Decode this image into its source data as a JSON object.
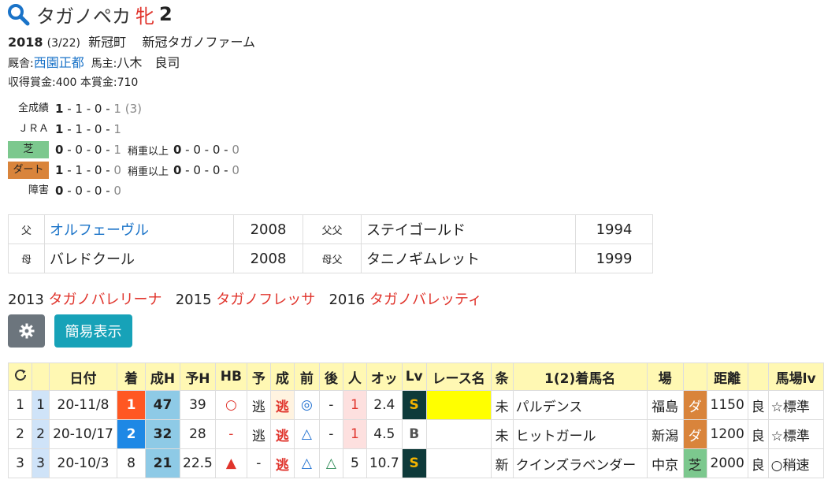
{
  "horse": {
    "name": "タガノペカ",
    "sex": "牝",
    "age": "2"
  },
  "info": {
    "birth_year": "2018",
    "birth_date": "(3/22)",
    "birthplace": "新冠町",
    "breeder": "新冠タガノファーム",
    "trainer_label": "厩舎:",
    "trainer": "西園正都",
    "owner_label": "馬主:",
    "owner": "八木　良司",
    "prize": "収得賞金:400 本賞金:710"
  },
  "records": [
    {
      "label": "全成績",
      "n1": "1",
      "n2": "1",
      "n3": "0",
      "n4": "1",
      "extra": "(3)"
    },
    {
      "label": "ＪＲＡ",
      "n1": "1",
      "n2": "1",
      "n3": "0",
      "n4": "1"
    },
    {
      "label": "芝",
      "n1": "0",
      "n2": "0",
      "n3": "0",
      "n4": "1",
      "sub": "稍重以上",
      "s1": "0",
      "s2": "0",
      "s3": "0",
      "s4": "0"
    },
    {
      "label": "ダート",
      "n1": "1",
      "n2": "1",
      "n3": "0",
      "n4": "0",
      "sub": "稍重以上",
      "s1": "0",
      "s2": "0",
      "s3": "0",
      "s4": "0"
    },
    {
      "label": "障害",
      "n1": "0",
      "n2": "0",
      "n3": "0",
      "n4": "0"
    }
  ],
  "pedigree": [
    {
      "k1": "父",
      "v1": "オルフェーヴル",
      "y1": "2008",
      "k2": "父父",
      "v2": "ステイゴールド",
      "y2": "1994"
    },
    {
      "k1": "母",
      "v1": "バレドクール",
      "y1": "2008",
      "k2": "母父",
      "v2": "タニノギムレット",
      "y2": "1999"
    }
  ],
  "siblings": [
    {
      "year": "2013",
      "name": "タガノバレリーナ"
    },
    {
      "year": "2015",
      "name": "タガノフレッサ"
    },
    {
      "year": "2016",
      "name": "タガノバレッティ"
    }
  ],
  "buttons": {
    "simple": "簡易表示"
  },
  "colors": {
    "accent_red": "#e0342c",
    "link_blue": "#1a73c8",
    "header_yellow": "#fff8b3",
    "btn_gray": "#6c757d",
    "btn_teal": "#17a2b8"
  },
  "table": {
    "headers": [
      "日付",
      "着",
      "成H",
      "予H",
      "HB",
      "予",
      "成",
      "前",
      "後",
      "人",
      "オッ",
      "Lv",
      "レース名",
      "条",
      "1(2)着馬名",
      "場",
      "",
      "距離",
      "",
      "馬場lv"
    ],
    "rows": [
      {
        "no": "1",
        "rc": "1",
        "date": "20-11/8",
        "pos": "1",
        "sh": "47",
        "yh": "39",
        "hb": "○",
        "yo": "逃",
        "sei": "逃",
        "mae": "◎",
        "ato": "-",
        "nin": "1",
        "odds": "2.4",
        "lv": "S",
        "race": "",
        "jo": "未",
        "winner": "パルデンス",
        "ba": "福島",
        "surf": "ダ",
        "dist": "1150",
        "cond": "良",
        "blv": "☆標準"
      },
      {
        "no": "2",
        "rc": "2",
        "date": "20-10/17",
        "pos": "2",
        "sh": "32",
        "yh": "28",
        "hb": "-",
        "yo": "逃",
        "sei": "逃",
        "mae": "△",
        "ato": "-",
        "nin": "1",
        "odds": "4.5",
        "lv": "B",
        "race": "",
        "jo": "未",
        "winner": "ヒットガール",
        "ba": "新潟",
        "surf": "ダ",
        "dist": "1200",
        "cond": "良",
        "blv": "☆標準"
      },
      {
        "no": "3",
        "rc": "3",
        "date": "20-10/3",
        "pos": "8",
        "sh": "21",
        "yh": "22.5",
        "hb": "▲",
        "yo": "-",
        "sei": "逃",
        "mae": "△",
        "ato": "△",
        "nin": "5",
        "odds": "10.7",
        "lv": "S",
        "race": "",
        "jo": "新",
        "winner": "クインズラベンダー",
        "ba": "中京",
        "surf": "芝",
        "dist": "2000",
        "cond": "良",
        "blv": "○稍速"
      }
    ]
  }
}
